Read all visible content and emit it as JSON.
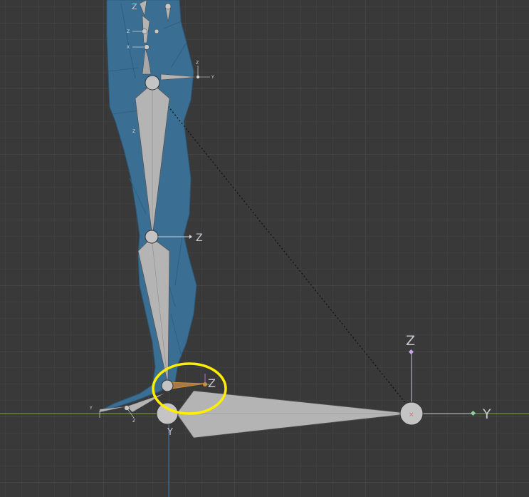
{
  "viewport": {
    "mode": "3D viewport (orthographic side view)",
    "colors": {
      "background": "#393939",
      "ground_axis": "#7fa63c",
      "vertical_axis": "#3b78b0",
      "mesh": "#3a6f93",
      "bone": "#b4b4b4",
      "highlight": "#ffee00",
      "selected_bone_tip": "#e08a2c"
    }
  },
  "axis_labels": {
    "hip_z": "Z",
    "knee_z": "Z",
    "ankle_z": "Z",
    "ik_target_z": "Z",
    "ik_target_y": "Y",
    "heel_y": "Y",
    "spine_z": "Z"
  },
  "mini_labels": {
    "z_upper": "Z",
    "x_upper": "X",
    "thigh_z": "Z",
    "thigh_y": "Y",
    "toe_z": "Z",
    "toe_y": "Y"
  },
  "icons": [
    "bone-gizmo-icon",
    "empty-axes-icon",
    "highlight-ring-icon"
  ]
}
